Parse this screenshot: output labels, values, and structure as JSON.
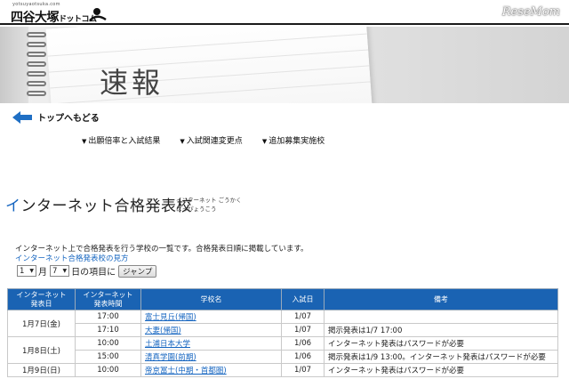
{
  "header": {
    "logo_subtext": "yotsuyaotsuka.com",
    "logo_main": "四谷大塚",
    "logo_suffix": "ドットコム",
    "watermark": "ReseMom"
  },
  "hero": {
    "title": "速報"
  },
  "nav": {
    "back_label": "トップへもどる",
    "anchors": [
      "出願倍率と入試結果",
      "入試関連変更点",
      "追加募集実施校"
    ]
  },
  "section": {
    "title_first": "イ",
    "title_rest": "ンターネット合格発表校",
    "furigana_line1": "インターネット ごうかく",
    "furigana_line2": "はっぴょうこう"
  },
  "intro": "インターネット上で合格発表を行う学校の一覧です。合格発表日順に掲載しています。",
  "help_link": "インターネット合格発表校の見方",
  "jump": {
    "month_value": "1",
    "month_suffix": "月",
    "day_value": "7",
    "day_suffix": "日の項目に",
    "button_label": "ジャンプ"
  },
  "table": {
    "headers": [
      "インターネット\n発表日",
      "インターネット\n発表時間",
      "学校名",
      "入試日",
      "備考"
    ],
    "rows": [
      {
        "date": "1月7日(金)",
        "time": "17:00",
        "school": "富士見丘(帰国)",
        "exam": "1/07",
        "note": ""
      },
      {
        "date": "",
        "time": "17:10",
        "school": "大妻(帰国)",
        "exam": "1/07",
        "note": "掲示発表は1/7 17:00"
      },
      {
        "date": "1月8日(土)",
        "time": "10:00",
        "school": "土浦日本大学",
        "exam": "1/06",
        "note": "インターネット発表はパスワードが必要"
      },
      {
        "date": "",
        "time": "15:00",
        "school": "清真学園(前期)",
        "exam": "1/06",
        "note": "掲示発表は1/9 13:00。インターネット発表はパスワードが必要"
      },
      {
        "date": "1月9日(日)",
        "time": "10:00",
        "school": "帝京冨士(中期・首都圏)",
        "exam": "1/07",
        "note": "インターネット発表はパスワードが必要"
      }
    ]
  }
}
